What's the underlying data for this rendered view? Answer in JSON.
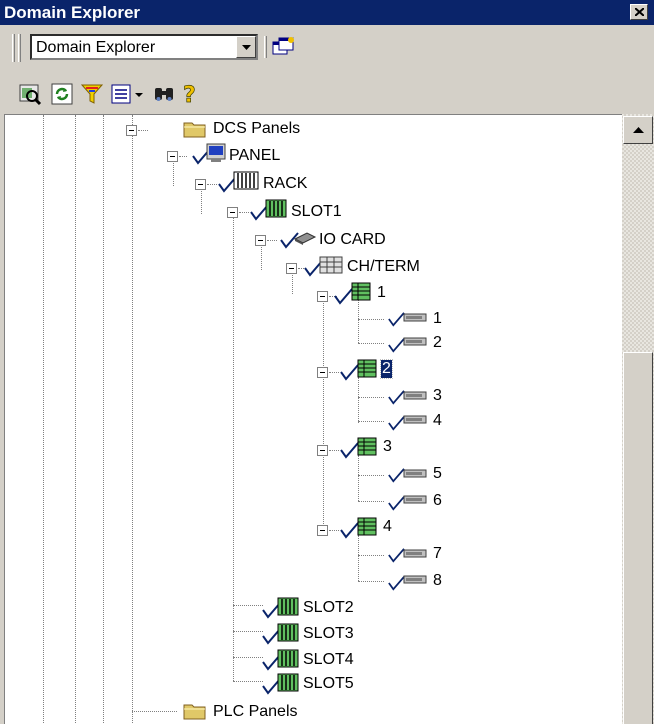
{
  "window": {
    "title": "Domain Explorer"
  },
  "toolbar": {
    "combo_value": "Domain Explorer",
    "buttons": [
      "locate-icon",
      "refresh-icon",
      "filter-icon",
      "view-icon",
      "find-icon",
      "help-icon"
    ]
  },
  "colors": {
    "titlebar": "#0a246a",
    "check": "#0a246a",
    "folder": "#e0c868",
    "selection": "#0a246a"
  },
  "tree": {
    "dcs_panels": "DCS Panels",
    "panel": "PANEL",
    "rack": "RACK",
    "slot1": "SLOT1",
    "io_card": "IO CARD",
    "ch_term": "CH/TERM",
    "ch1": "1",
    "ch1_t1": "1",
    "ch1_t2": "2",
    "ch2": "2",
    "ch2_t1": "3",
    "ch2_t2": "4",
    "ch3": "3",
    "ch3_t1": "5",
    "ch3_t2": "6",
    "ch4": "4",
    "ch4_t1": "7",
    "ch4_t2": "8",
    "slot2": "SLOT2",
    "slot3": "SLOT3",
    "slot4": "SLOT4",
    "slot5": "SLOT5",
    "plc_panels": "PLC Panels"
  }
}
